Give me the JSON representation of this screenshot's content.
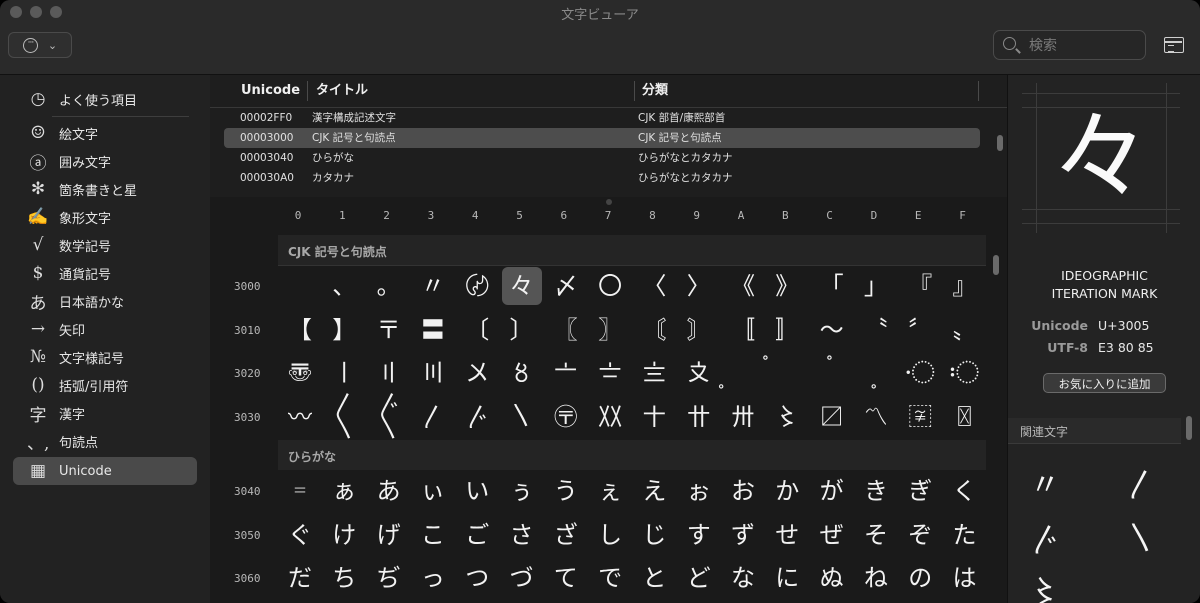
{
  "window": {
    "title": "文字ビューア"
  },
  "toolbar": {
    "action_icon": "ellipsis-circle-icon",
    "chevron": "⌄",
    "search_placeholder": "検索"
  },
  "sidebar": {
    "items": [
      {
        "icon": "◷",
        "label": "よく使う項目"
      },
      {
        "icon": "☺",
        "label": "絵文字"
      },
      {
        "icon": "ⓐ",
        "label": "囲み文字"
      },
      {
        "icon": "✻",
        "label": "箇条書きと星"
      },
      {
        "icon": "✍",
        "label": "象形文字"
      },
      {
        "icon": "√",
        "label": "数学記号"
      },
      {
        "icon": "$",
        "label": "通貨記号"
      },
      {
        "icon": "あ",
        "label": "日本語かな"
      },
      {
        "icon": "→",
        "label": "矢印"
      },
      {
        "icon": "№",
        "label": "文字様記号"
      },
      {
        "icon": "()",
        "label": "括弧/引用符"
      },
      {
        "icon": "字",
        "label": "漢字"
      },
      {
        "icon": "、,",
        "label": "句読点"
      },
      {
        "icon": "▦",
        "label": "Unicode"
      }
    ],
    "selected": "Unicode"
  },
  "table": {
    "headers": [
      "Unicode",
      "タイトル",
      "分類"
    ],
    "rows": [
      {
        "code": "00002FF0",
        "title": "漢字構成記述文字",
        "category": "CJK 部首/康熙部首"
      },
      {
        "code": "00003000",
        "title": "CJK 記号と句読点",
        "category": "CJK 記号と句読点"
      },
      {
        "code": "00003040",
        "title": "ひらがな",
        "category": "ひらがなとカタカナ"
      },
      {
        "code": "000030A0",
        "title": "カタカナ",
        "category": "ひらがなとカタカナ"
      }
    ]
  },
  "grid": {
    "columns": [
      "0",
      "1",
      "2",
      "3",
      "4",
      "5",
      "6",
      "7",
      "8",
      "9",
      "A",
      "B",
      "C",
      "D",
      "E",
      "F"
    ],
    "sections": [
      {
        "label": "CJK 記号と句読点",
        "rows": [
          {
            "code": "3000",
            "chars": [
              " ",
              "、",
              "。",
              "〃",
              "〄",
              "々",
              "〆",
              "〇",
              "〈",
              "〉",
              "《",
              "》",
              "「",
              "」",
              "『",
              "』"
            ]
          },
          {
            "code": "3010",
            "chars": [
              "【",
              "】",
              "〒",
              "〓",
              "〔",
              "〕",
              "〖",
              "〗",
              "〘",
              "〙",
              "〚",
              "〛",
              "〜",
              "〝",
              "〞",
              "〟"
            ]
          },
          {
            "code": "3020",
            "chars": [
              "〠",
              "〡",
              "〢",
              "〣",
              "〤",
              "〥",
              "〦",
              "〧",
              "〨",
              "〩",
              "〪",
              "〫",
              "〬",
              "〭",
              "〮",
              "〯"
            ]
          },
          {
            "code": "3030",
            "chars": [
              "〰",
              "〱",
              "〲",
              "〳",
              "〴",
              "〵",
              "〶",
              "〷",
              "〸",
              "〹",
              "〺",
              "〻",
              "〼",
              "〽",
              "〾",
              "〿"
            ]
          }
        ]
      },
      {
        "label": "ひらがな",
        "rows": [
          {
            "code": "3040",
            "chars": [
              "゠",
              "ぁ",
              "あ",
              "ぃ",
              "い",
              "ぅ",
              "う",
              "ぇ",
              "え",
              "ぉ",
              "お",
              "か",
              "が",
              "き",
              "ぎ",
              "く"
            ]
          },
          {
            "code": "3050",
            "chars": [
              "ぐ",
              "け",
              "げ",
              "こ",
              "ご",
              "さ",
              "ざ",
              "し",
              "じ",
              "す",
              "ず",
              "せ",
              "ぜ",
              "そ",
              "ぞ",
              "た"
            ]
          },
          {
            "code": "3060",
            "chars": [
              "だ",
              "ち",
              "ぢ",
              "っ",
              "つ",
              "づ",
              "て",
              "で",
              "と",
              "ど",
              "な",
              "に",
              "ぬ",
              "ね",
              "の",
              "は"
            ]
          }
        ]
      }
    ],
    "selected": {
      "row": 0,
      "col": 5
    }
  },
  "detail": {
    "glyph": "々",
    "name_line1": "IDEOGRAPHIC",
    "name_line2": "ITERATION MARK",
    "unicode_label": "Unicode",
    "unicode_value": "U+3005",
    "utf8_label": "UTF-8",
    "utf8_value": "E3 80 85",
    "favorite_button": "お気に入りに追加",
    "related_label": "関連文字",
    "related": [
      "〃",
      "〳",
      "〴",
      "〵",
      "〻"
    ]
  }
}
